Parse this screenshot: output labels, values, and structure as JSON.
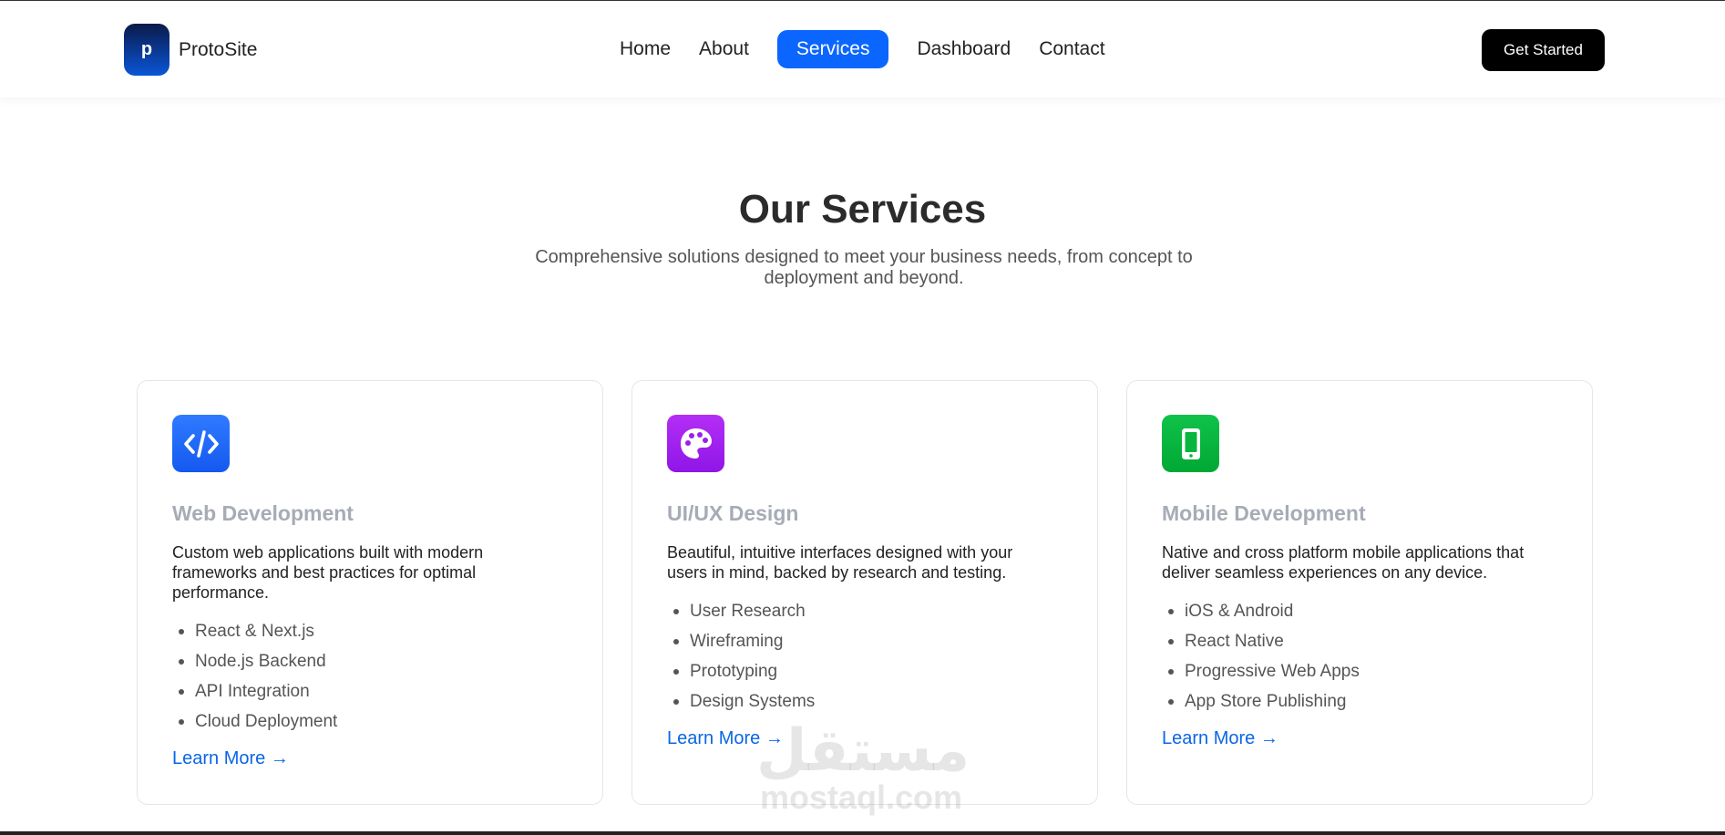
{
  "brand": {
    "logo_letter": "p",
    "name": "ProtoSite"
  },
  "nav": {
    "items": [
      "Home",
      "About",
      "Services",
      "Dashboard",
      "Contact"
    ],
    "active": "Services"
  },
  "cta_label": "Get Started",
  "hero": {
    "title": "Our Services",
    "subtitle": "Comprehensive solutions designed to meet your business needs, from concept to deployment and beyond."
  },
  "cards": [
    {
      "icon": "code-icon",
      "icon_color": "#1f6bff",
      "title": "Web Development",
      "description": "Custom web applications built with modern frameworks and best practices for optimal performance.",
      "features": [
        "React & Next.js",
        "Node.js Backend",
        "API Integration",
        "Cloud Deployment"
      ],
      "link": "Learn More →"
    },
    {
      "icon": "palette-icon",
      "icon_color": "#a020f0",
      "title": "UI/UX Design",
      "description": "Beautiful, intuitive interfaces designed with your users in mind, backed by research and testing.",
      "features": [
        "User Research",
        "Wireframing",
        "Prototyping",
        "Design Systems"
      ],
      "link": "Learn More →"
    },
    {
      "icon": "smartphone-icon",
      "icon_color": "#00b33c",
      "title": "Mobile Development",
      "description": "Native and cross platform mobile applications that deliver seamless experiences on any device.",
      "features": [
        "iOS & Android",
        "React Native",
        "Progressive Web Apps",
        "App Store Publishing"
      ],
      "link": "Learn More →"
    }
  ],
  "watermark": {
    "arabic": "مستقل",
    "latin": "mostaql.com"
  }
}
